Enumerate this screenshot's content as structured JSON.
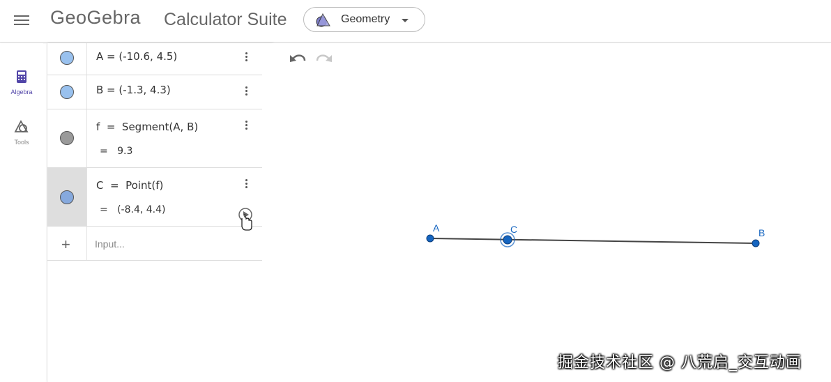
{
  "header": {
    "logo": "GeoGebra",
    "suite_title": "Calculator Suite",
    "app_select": "Geometry"
  },
  "nav": {
    "algebra_label": "Algebra",
    "tools_label": "Tools"
  },
  "algebra": {
    "rows": [
      {
        "expr": "A = (-10.6, 4.5)",
        "color": "#99c1ee"
      },
      {
        "expr": "B = (-1.3, 4.3)",
        "color": "#99c1ee"
      },
      {
        "expr": "f  =  Segment(A, B)",
        "value": "=   9.3",
        "color": "#9a9a9a"
      },
      {
        "expr": "C  =  Point(f)",
        "value": "=   (-8.4, 4.4)",
        "color": "#86a9dd"
      }
    ],
    "input_placeholder": "Input..."
  },
  "graphics": {
    "labels": {
      "A": "A",
      "B": "B",
      "C": "C"
    },
    "point_color": "#1565c0",
    "segment_color": "#444444"
  },
  "watermark": "掘金技术社区 @ 八荒启_交互动画"
}
